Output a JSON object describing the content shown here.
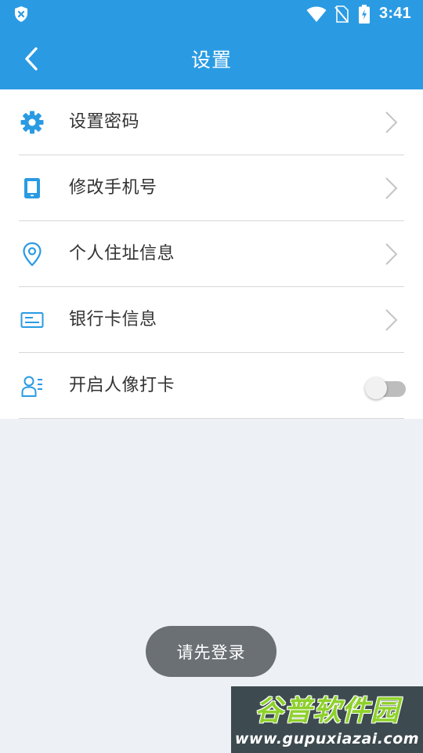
{
  "status_bar": {
    "time": "3:41",
    "icons": [
      "shield-x-icon",
      "wifi-icon",
      "no-sim-icon",
      "battery-charging-icon"
    ]
  },
  "header": {
    "title": "设置",
    "back_icon": "chevron-left-icon"
  },
  "settings": [
    {
      "label": "设置密码",
      "icon": "gear-icon",
      "control": "chevron"
    },
    {
      "label": "修改手机号",
      "icon": "phone-icon",
      "control": "chevron"
    },
    {
      "label": "个人住址信息",
      "icon": "location-pin-icon",
      "control": "chevron"
    },
    {
      "label": "银行卡信息",
      "icon": "bank-card-icon",
      "control": "chevron"
    },
    {
      "label": "开启人像打卡",
      "icon": "person-list-icon",
      "control": "toggle",
      "toggle_on": false
    }
  ],
  "toast": {
    "message": "请先登录"
  },
  "watermark": {
    "title": "谷普软件园",
    "url": "www.gupuxiazai.com"
  },
  "colors": {
    "primary": "#2a9be3",
    "background": "#edf1f5",
    "toast_bg": "#6b7075",
    "watermark_green": "#8ed12b"
  }
}
